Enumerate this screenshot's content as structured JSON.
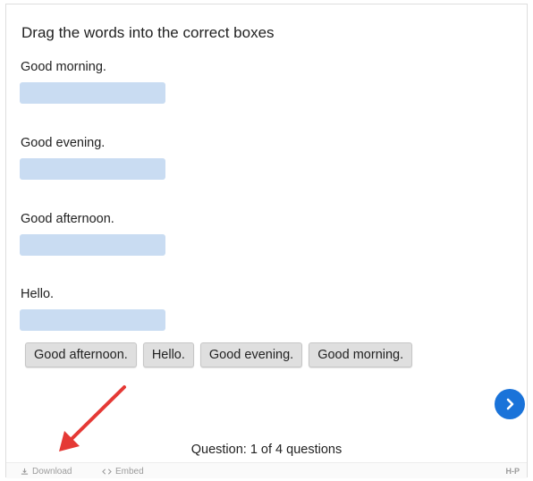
{
  "task": {
    "title": "Drag the words into the correct boxes"
  },
  "items": [
    {
      "label": "Good morning."
    },
    {
      "label": "Good evening."
    },
    {
      "label": "Good afternoon."
    },
    {
      "label": "Hello."
    }
  ],
  "word_bank": [
    "Good afternoon.",
    "Hello.",
    "Good evening.",
    "Good morning."
  ],
  "progress": {
    "text": "Question: 1 of 4 questions"
  },
  "footer": {
    "download_label": "Download",
    "embed_label": "Embed",
    "brand": "H-P"
  },
  "icons": {
    "next": "chevron-right-icon",
    "download": "download-icon",
    "embed": "code-icon"
  },
  "colors": {
    "dropzone": "#c9dcf2",
    "next_button": "#1a73d9",
    "annotation_arrow": "#e53935"
  }
}
